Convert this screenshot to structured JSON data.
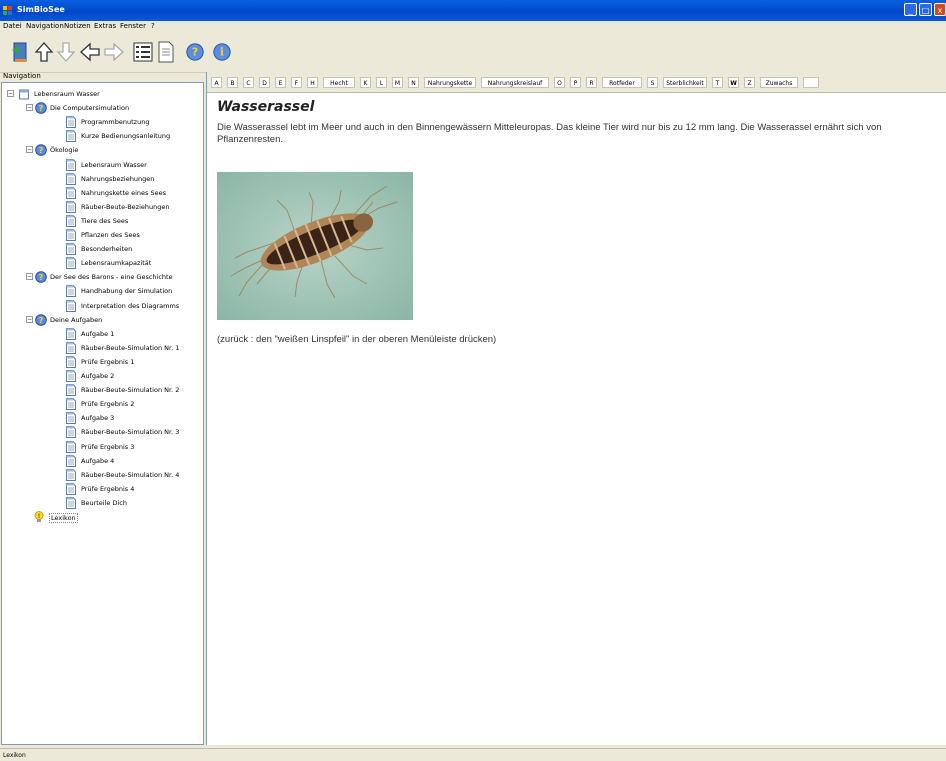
{
  "window": {
    "title": "SimBioSee"
  },
  "menu": [
    "Datei",
    "Navigation",
    "Notizen",
    "Extras",
    "Fenster",
    "?"
  ],
  "toolbar": {
    "icons": [
      "exit-icon",
      "up-arrow-icon",
      "down-arrow-icon",
      "back-arrow-icon",
      "forward-arrow-icon",
      "tree-view-icon",
      "page-icon",
      "help-icon",
      "info-icon"
    ]
  },
  "nav": {
    "header": "Navigation",
    "tree": [
      {
        "label": "Lebensraum Wasser"
      },
      {
        "label": "Die Computersimulation"
      },
      {
        "label": "Programmbenutzung"
      },
      {
        "label": "Kurze Bedienungsanleitung"
      },
      {
        "label": "Ökologie"
      },
      {
        "label": "Lebensraum Wasser"
      },
      {
        "label": "Nahrungsbeziehungen"
      },
      {
        "label": "Nahrungskette eines Sees"
      },
      {
        "label": "Räuber-Beute-Beziehungen"
      },
      {
        "label": "Tiere des Sees"
      },
      {
        "label": "Pflanzen des Sees"
      },
      {
        "label": "Besonderheiten"
      },
      {
        "label": "Lebensraumkapazität"
      },
      {
        "label": "Der See des Barons - eine Geschichte"
      },
      {
        "label": "Handhabung der Simulation"
      },
      {
        "label": "Interpretation des Diagramms"
      },
      {
        "label": "Deine Aufgaben"
      },
      {
        "label": "Aufgabe 1"
      },
      {
        "label": "Räuber-Beute-Simulation Nr. 1"
      },
      {
        "label": "Prüfe Ergebnis 1"
      },
      {
        "label": "Aufgabe 2"
      },
      {
        "label": "Räuber-Beute-Simulation Nr. 2"
      },
      {
        "label": "Prüfe Ergebnis 2"
      },
      {
        "label": "Aufgabe 3"
      },
      {
        "label": "Räuber-Beute-Simulation Nr. 3"
      },
      {
        "label": "Prüfe Ergebnis 3"
      },
      {
        "label": "Aufgabe 4"
      },
      {
        "label": "Räuber-Beute-Simulation Nr. 4"
      },
      {
        "label": "Prüfe Ergebnis 4"
      },
      {
        "label": "Beurteile Dich"
      },
      {
        "label": "Lexikon"
      }
    ]
  },
  "alphabet": [
    "A",
    "B",
    "C",
    "D",
    "E",
    "F",
    "H",
    "Hecht",
    "K",
    "L",
    "M",
    "N",
    "Nahrungskette",
    "Nahrungskreislauf",
    "O",
    "P",
    "R",
    "Rotfeder",
    "S",
    "Sterblichkeit",
    "T",
    "W",
    "Z",
    "Zuwachs",
    ""
  ],
  "article": {
    "title": "Wasserassel",
    "body": "Die Wasserassel lebt im Meer und auch in den Binnengewässern Mitteleuropas. Das kleine Tier wird nur bis zu 12 mm lang. Die Wasserassel ernährt sich von Pflanzenresten.",
    "back_note": "(zurück : den \"weißen Linspfeil\" in der oberen Menüleiste drücken)"
  },
  "status": {
    "text": "Lexikon"
  }
}
